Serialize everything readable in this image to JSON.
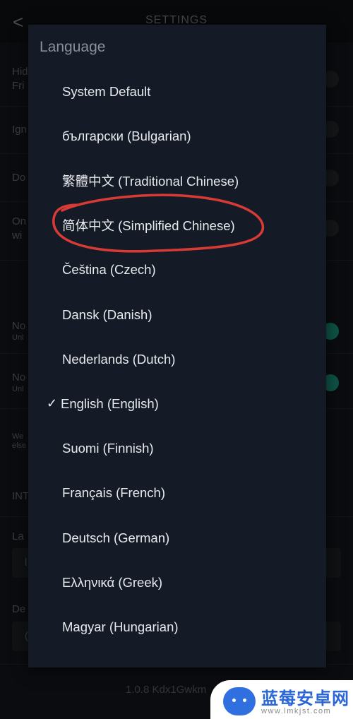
{
  "header": {
    "title": "SETTINGS",
    "back_icon": "chevron-left-icon"
  },
  "background_rows": [
    {
      "line1": "Hid",
      "line2": "Fri"
    },
    {
      "line1": "Ign",
      "line2": ""
    },
    {
      "line1": "Do",
      "line2": ""
    },
    {
      "line1": "On",
      "line2": "wi"
    },
    {
      "line1": "No",
      "sub": "Unl"
    },
    {
      "line1": "No",
      "sub": "Unl"
    },
    {
      "sub1": "We",
      "sub2": "else"
    },
    {
      "line1": "INT"
    },
    {
      "line1": "La",
      "box": "l"
    },
    {
      "line1": "De",
      "box": "("
    }
  ],
  "version": "1.0.8 Kdx1Gwkm",
  "dialog": {
    "title": "Language",
    "selected": "English (English)",
    "check_mark": "✓",
    "items": [
      "System Default",
      "български (Bulgarian)",
      "繁體中文 (Traditional Chinese)",
      "简体中文 (Simplified Chinese)",
      "Čeština (Czech)",
      "Dansk (Danish)",
      "Nederlands (Dutch)",
      "English (English)",
      "Suomi (Finnish)",
      "Français (French)",
      "Deutsch (German)",
      "Ελληνικά (Greek)",
      "Magyar (Hungarian)"
    ]
  },
  "annotation": {
    "color": "#d83a35",
    "target": "简体中文 (Simplified Chinese)"
  },
  "watermark": {
    "name": "蓝莓安卓网",
    "url": "www.lmkjst.com"
  },
  "colors": {
    "toggle_on": "#14806a",
    "dialog_bg": "#141a26"
  }
}
